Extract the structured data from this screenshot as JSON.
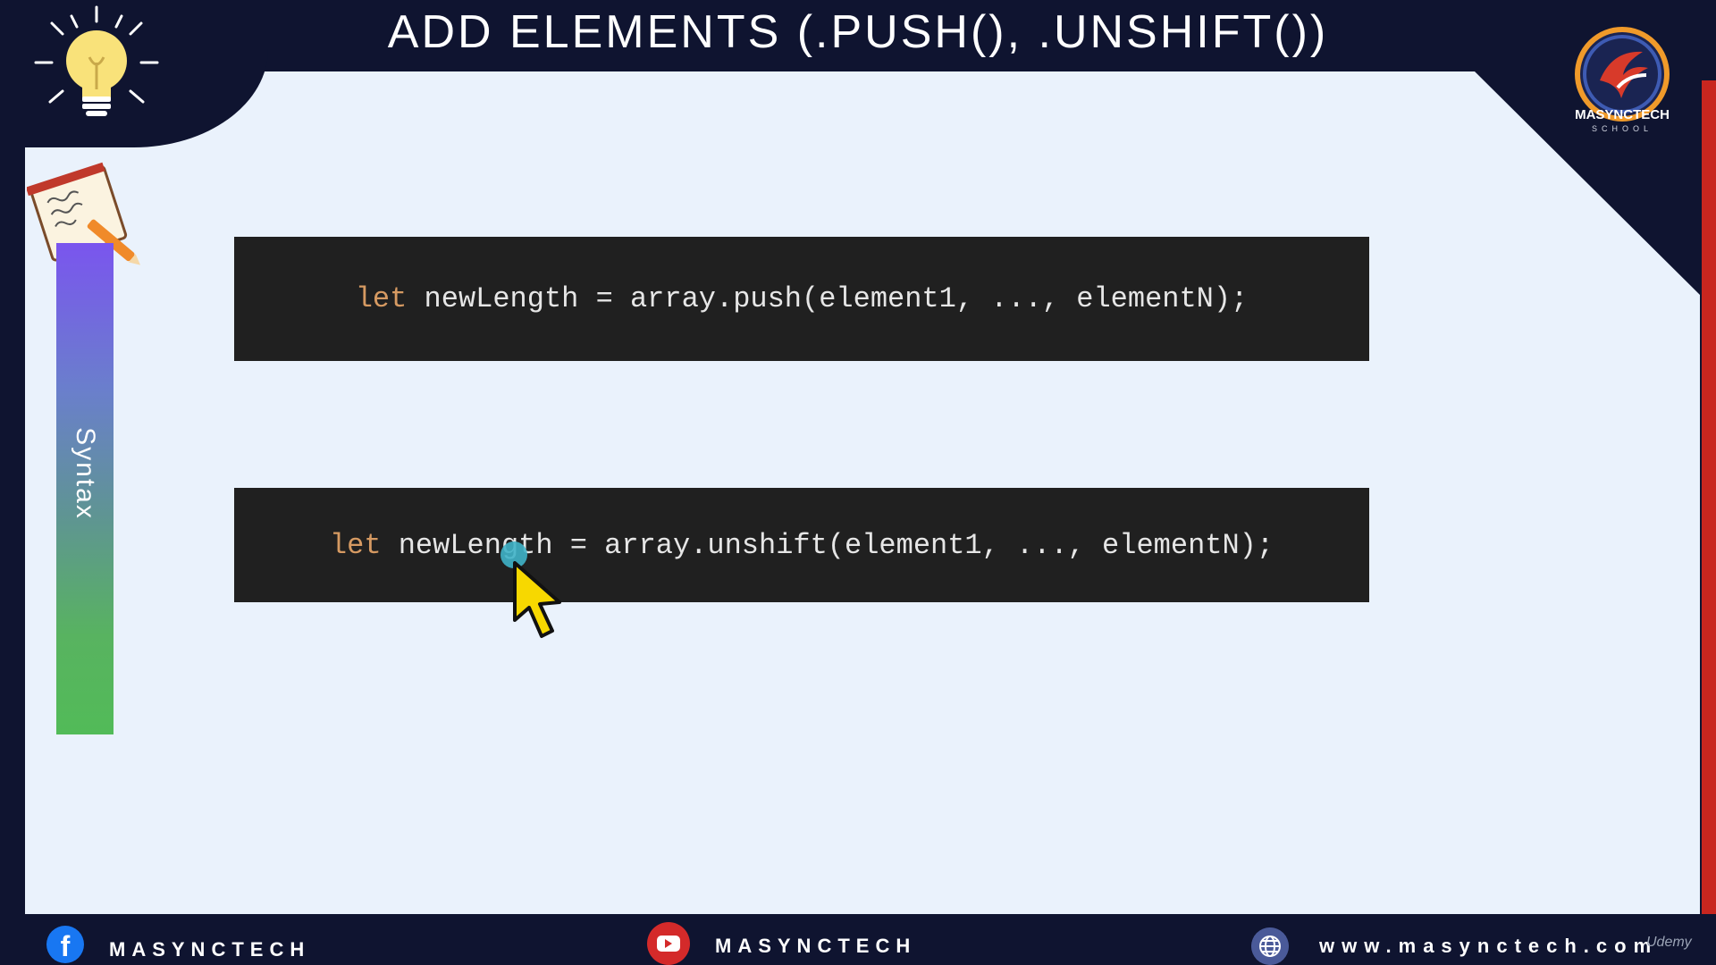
{
  "header": {
    "title": "ADD ELEMENTS (.PUSH(), .UNSHIFT())"
  },
  "logo": {
    "name": "MASYNCTECH",
    "sub": "SCHOOL"
  },
  "sidebar": {
    "label": "Syntax"
  },
  "code_blocks": [
    {
      "keyword": "let",
      "rest": " newLength = array.push(element1, ..., elementN);"
    },
    {
      "keyword": "let",
      "rest": " newLength = array.unshift(element1, ..., elementN);"
    }
  ],
  "footer": {
    "facebook": "MASYNCTECH",
    "youtube": "MASYNCTECH",
    "website": "www.masynctech.com",
    "watermark": "Udemy"
  },
  "colors": {
    "background_dark": "#0f1430",
    "panel": "#eaf2fc",
    "code_bg": "#202020",
    "keyword": "#d69a62",
    "accent_red": "#c8261f"
  },
  "icons": [
    "lightbulb-icon",
    "notepad-pen-icon",
    "facebook-icon",
    "youtube-icon",
    "globe-icon",
    "mouse-cursor-icon"
  ]
}
